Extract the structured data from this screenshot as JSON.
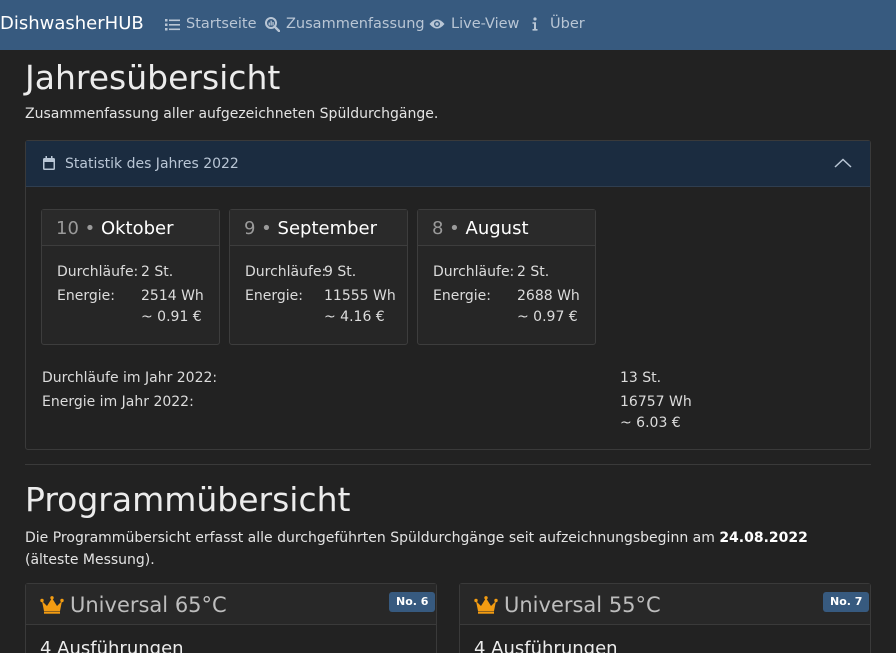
{
  "navbar": {
    "brand": "DishwasherHUB",
    "items": [
      {
        "label": "Startseite",
        "icon": "list-icon"
      },
      {
        "label": "Zusammenfassung",
        "icon": "search-chart-icon"
      },
      {
        "label": "Live-View",
        "icon": "eye-icon"
      },
      {
        "label": "Über",
        "icon": "info-icon"
      }
    ]
  },
  "colors": {
    "navbar": "#375a7f",
    "badge": "#375a7f",
    "crown": "#f39c12",
    "background": "#222222"
  },
  "yearly": {
    "title": "Jahresübersicht",
    "subtitle": "Zusammenfassung aller aufgezeichneten Spüldurchgänge.",
    "card_header": "Statistik des Jahres 2022",
    "months": [
      {
        "num": "10",
        "name": "Oktober",
        "runs_label": "Durchläufe:",
        "runs": "2 St.",
        "energy_label": "Energie:",
        "energy": "2514 Wh",
        "cost": "~ 0.91 €"
      },
      {
        "num": "9",
        "name": "September",
        "runs_label": "Durchläufe:",
        "runs": "9 St.",
        "energy_label": "Energie:",
        "energy": "11555 Wh",
        "cost": "~ 4.16 €"
      },
      {
        "num": "8",
        "name": "August",
        "runs_label": "Durchläufe:",
        "runs": "2 St.",
        "energy_label": "Energie:",
        "energy": "2688 Wh",
        "cost": "~ 0.97 €"
      }
    ],
    "totals": {
      "runs_label": "Durchläufe im Jahr 2022:",
      "runs": "13 St.",
      "energy_label": "Energie im Jahr 2022:",
      "energy": "16757 Wh",
      "cost": "~ 6.03 €"
    }
  },
  "programs": {
    "title": "Programmübersicht",
    "desc_before": "Die Programmübersicht erfasst alle durchgeführten Spüldurchgänge seit aufzeichnungsbeginn am ",
    "desc_date": "24.08.2022",
    "desc_after": " (älteste Messung).",
    "cards": [
      {
        "name": "Universal 65°C",
        "badge": "No. 6",
        "runs": "4 Ausführungen"
      },
      {
        "name": "Universal 55°C",
        "badge": "No. 7",
        "runs": "4 Ausführungen"
      }
    ]
  }
}
